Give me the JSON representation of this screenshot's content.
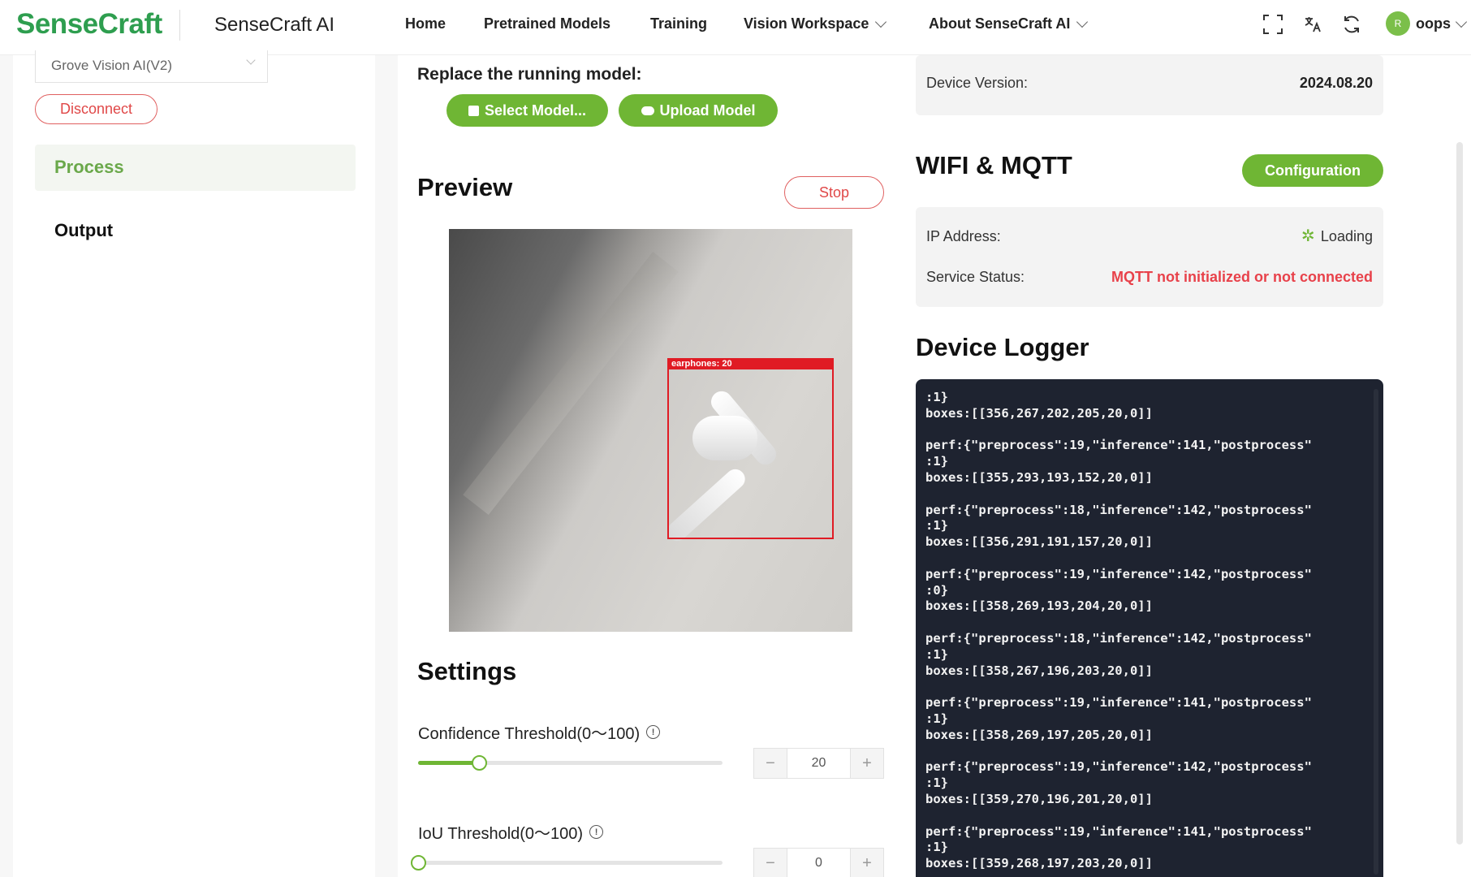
{
  "header": {
    "logo": "SenseCraft",
    "app_name": "SenseCraft AI",
    "nav": {
      "home": "Home",
      "pretrained_models": "Pretrained Models",
      "training": "Training",
      "vision_workspace": "Vision Workspace",
      "about": "About SenseCraft AI"
    },
    "icons": [
      "fullscreen-icon",
      "translate-icon",
      "refresh-icon"
    ],
    "avatar_letter": "R",
    "user_name": "oops"
  },
  "sidebar": {
    "device_select": "Grove Vision AI(V2)",
    "disconnect_label": "Disconnect",
    "items": [
      {
        "label": "Process",
        "active": true
      },
      {
        "label": "Output",
        "active": false
      }
    ]
  },
  "center": {
    "replace_title": "Replace the running model:",
    "select_model_label": "Select Model...",
    "upload_model_label": "Upload Model",
    "preview_title": "Preview",
    "stop_label": "Stop",
    "detection_label": "earphones: 20",
    "settings_title": "Settings",
    "confidence": {
      "label": "Confidence Threshold(0～100)",
      "value": "20",
      "level": 20
    },
    "iou": {
      "label": "IoU Threshold(0～100)",
      "value": "0",
      "level": 0
    },
    "minus": "−",
    "plus": "+"
  },
  "right": {
    "device_version_label": "Device Version:",
    "device_version_value": "2024.08.20",
    "wifi_title": "WIFI & MQTT",
    "config_label": "Configuration",
    "ip_label": "IP Address:",
    "ip_value": "Loading",
    "service_label": "Service Status:",
    "service_value": "MQTT not initialized or not connected",
    "logger_title": "Device Logger",
    "log_lines": [
      ":1}",
      "boxes:[[356,267,202,205,20,0]]",
      "",
      "perf:{\"preprocess\":19,\"inference\":141,\"postprocess\"",
      ":1}",
      "boxes:[[355,293,193,152,20,0]]",
      "",
      "perf:{\"preprocess\":18,\"inference\":142,\"postprocess\"",
      ":1}",
      "boxes:[[356,291,191,157,20,0]]",
      "",
      "perf:{\"preprocess\":19,\"inference\":142,\"postprocess\"",
      ":0}",
      "boxes:[[358,269,193,204,20,0]]",
      "",
      "perf:{\"preprocess\":18,\"inference\":142,\"postprocess\"",
      ":1}",
      "boxes:[[358,267,196,203,20,0]]",
      "",
      "perf:{\"preprocess\":19,\"inference\":141,\"postprocess\"",
      ":1}",
      "boxes:[[358,269,197,205,20,0]]",
      "",
      "perf:{\"preprocess\":19,\"inference\":142,\"postprocess\"",
      ":1}",
      "boxes:[[359,270,196,201,20,0]]",
      "",
      "perf:{\"preprocess\":19,\"inference\":141,\"postprocess\"",
      ":1}",
      "boxes:[[359,268,197,203,20,0]]"
    ]
  },
  "colors": {
    "accent": "#6fb634",
    "danger": "#e04848",
    "logger_bg": "#1e2330"
  }
}
